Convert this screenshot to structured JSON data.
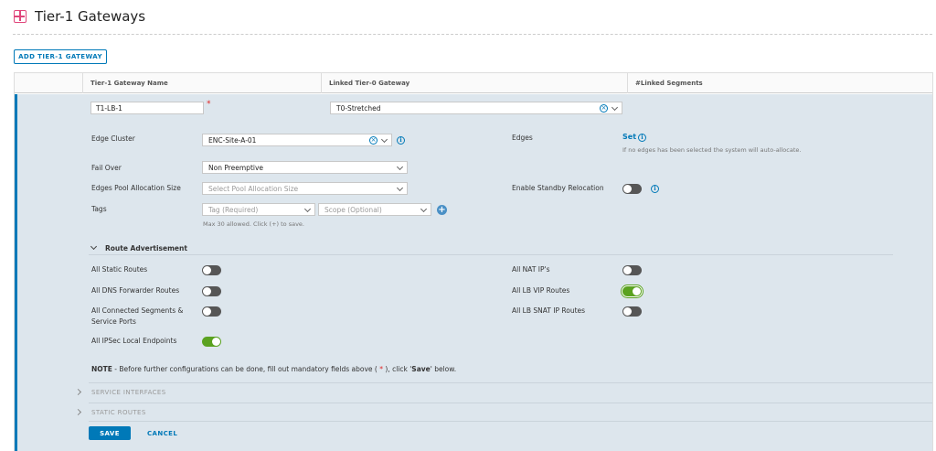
{
  "page": {
    "title": "Tier-1 Gateways"
  },
  "toolbar": {
    "add_label": "ADD TIER-1 GATEWAY"
  },
  "table": {
    "columns": [
      "Tier-1 Gateway Name",
      "Linked Tier-0 Gateway",
      "#Linked Segments"
    ]
  },
  "row": {
    "name_value": "T1-LB-1",
    "required_mark": "*",
    "tier0_value": "T0-Stretched"
  },
  "form": {
    "edge_cluster": {
      "label": "Edge Cluster",
      "value": "ENC-Site-A-01"
    },
    "edges": {
      "label": "Edges",
      "link": "Set",
      "hint": "If no edges has been selected the system will auto-allocate."
    },
    "fail_over": {
      "label": "Fail Over",
      "value": "Non Preemptive"
    },
    "pool_size": {
      "label": "Edges Pool Allocation Size",
      "placeholder": "Select Pool Allocation Size"
    },
    "standby": {
      "label": "Enable Standby Relocation",
      "on": false
    },
    "tags": {
      "label": "Tags",
      "tag_placeholder": "Tag (Required)",
      "scope_placeholder": "Scope (Optional)",
      "hint": "Max 30 allowed. Click (+) to save."
    }
  },
  "route_advertisement": {
    "title": "Route Advertisement",
    "left": [
      {
        "label": "All Static Routes",
        "on": false
      },
      {
        "label": "All DNS Forwarder Routes",
        "on": false
      },
      {
        "label_line1": "All Connected Segments &",
        "label_line2": "Service Ports",
        "on": false
      },
      {
        "label": "All IPSec Local Endpoints",
        "on": true
      }
    ],
    "right": [
      {
        "label": "All NAT IP's",
        "on": false
      },
      {
        "label": "All LB VIP Routes",
        "on": true
      },
      {
        "label": "All LB SNAT IP Routes",
        "on": false
      }
    ]
  },
  "note": {
    "bold": "NOTE",
    "text1": " - Before further configurations can be done, fill out mandatory fields above ( ",
    "star": "*",
    "text2": " ), click '",
    "save_word": "Save",
    "text3": "' below."
  },
  "sections": [
    "SERVICE INTERFACES",
    "STATIC ROUTES"
  ],
  "actions": {
    "save": "SAVE",
    "cancel": "CANCEL"
  },
  "colors": {
    "accent": "#0079b8",
    "toggle_on": "#5aa220",
    "toggle_off": "#565656",
    "row_bg": "#dde6ed",
    "title_icon": "#e0457b"
  }
}
